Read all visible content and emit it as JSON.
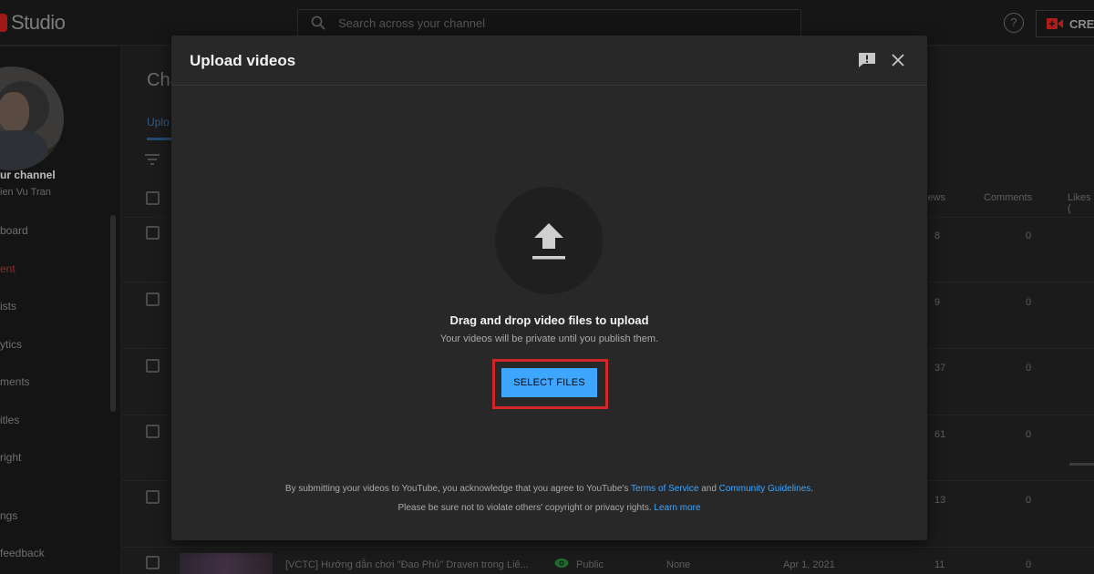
{
  "header": {
    "app_name": "Studio",
    "search_placeholder": "Search across your channel",
    "help_glyph": "?",
    "create_label": "CREA"
  },
  "sidebar": {
    "channel_title": "ur channel",
    "channel_name": "ien Vu Tran",
    "items": [
      "board",
      "ent",
      "ists",
      "ytics",
      "ments",
      "itles",
      "right",
      "ngs",
      "feedback"
    ]
  },
  "content": {
    "title": "Cha",
    "tab": "Uplo",
    "columns": {
      "views": "iews",
      "comments": "Comments",
      "likes": "Likes ("
    },
    "rows": [
      {
        "views": "8",
        "comments": "0"
      },
      {
        "views": "9",
        "comments": "0"
      },
      {
        "views": "37",
        "comments": "0"
      },
      {
        "views": "61",
        "comments": "0"
      },
      {
        "views": "13",
        "comments": "0"
      },
      {
        "views": "11",
        "comments": "0",
        "title": "[VCTC] Hướng dẫn chơi \"Đao Phủ\" Draven trong Liê...",
        "visibility": "Public",
        "restrictions": "None",
        "date": "Apr 1, 2021"
      }
    ]
  },
  "modal": {
    "title": "Upload videos",
    "drag_title": "Drag and drop video files to upload",
    "drag_sub": "Your videos will be private until you publish them.",
    "select_button": "SELECT FILES",
    "legal_prefix": "By submitting your videos to YouTube, you acknowledge that you agree to YouTube's ",
    "terms_link": "Terms of Service",
    "legal_and": " and ",
    "guidelines_link": "Community Guidelines",
    "legal_end": ".",
    "privacy_text": "Please be sure not to violate others' copyright or privacy rights. ",
    "learn_more": "Learn more"
  },
  "colors": {
    "accent_blue": "#3ea6ff",
    "highlight_red": "#d2252c",
    "modal_bg": "#282828"
  },
  "icons": [
    "search-icon",
    "help-icon",
    "create-camera-icon",
    "filter-icon",
    "feedback-icon",
    "close-icon",
    "upload-arrow-icon",
    "public-eye-icon"
  ]
}
